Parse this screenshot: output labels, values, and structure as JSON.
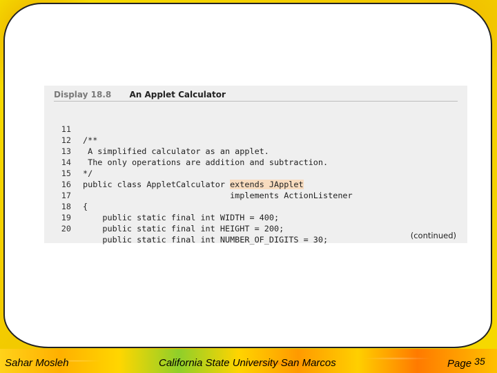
{
  "display": {
    "label": "Display 18.8",
    "title": "An Applet Calculator",
    "continued": "(continued)"
  },
  "code_lines": [
    {
      "num": "11",
      "text": "/**"
    },
    {
      "num": "12",
      "text": " A simplified calculator as an applet."
    },
    {
      "num": "13",
      "text": " The only operations are addition and subtraction."
    },
    {
      "num": "14",
      "text": "*/"
    },
    {
      "num": "15",
      "text_before": "public class AppletCalculator ",
      "text_highlight": "extends JApplet"
    },
    {
      "num": "16",
      "text": "                              implements ActionListener"
    },
    {
      "num": "17",
      "text": "{"
    },
    {
      "num": "18",
      "text": "    public static final int WIDTH = 400;"
    },
    {
      "num": "19",
      "text": "    public static final int HEIGHT = 200;"
    },
    {
      "num": "20",
      "text": "    public static final int NUMBER_OF_DIGITS = 30;"
    }
  ],
  "footer": {
    "author": "Sahar Mosleh",
    "university": "California State University San Marcos",
    "page_label": "Page",
    "page_number": "35"
  },
  "colors": {
    "highlight": "#f8dcbf",
    "frame_background": "#f4d400"
  }
}
